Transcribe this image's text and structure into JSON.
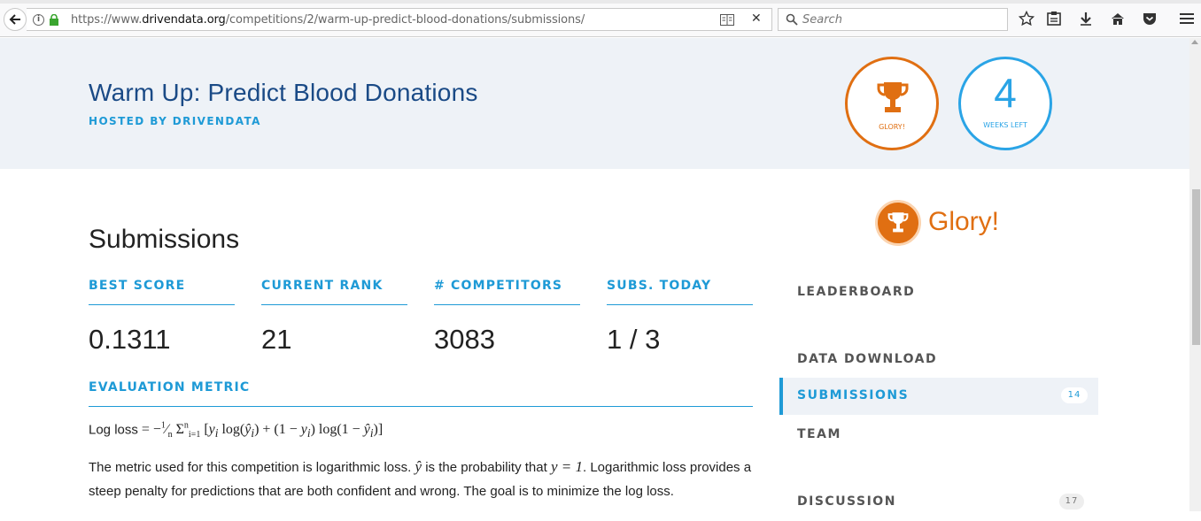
{
  "browser": {
    "url_prefix": "https://www.",
    "url_domain": "drivendata.org",
    "url_path": "/competitions/2/warm-up-predict-blood-donations/submissions/",
    "search_placeholder": "Search"
  },
  "header": {
    "title": "Warm Up: Predict Blood Donations",
    "hosted_by": "HOSTED BY DRIVENDATA",
    "glory_badge_label": "GLORY!",
    "weeks_number": "4",
    "weeks_label": "WEEKS LEFT"
  },
  "main": {
    "heading": "Submissions",
    "stats": [
      {
        "label": "BEST SCORE",
        "value": "0.1311"
      },
      {
        "label": "CURRENT RANK",
        "value": "21"
      },
      {
        "label": "# COMPETITORS",
        "value": "3083"
      },
      {
        "label": "SUBS. TODAY",
        "value": "1 / 3"
      }
    ],
    "evaluation_label": "EVALUATION METRIC",
    "formula_prefix": "Log loss",
    "para_1": "The metric used for this competition is logarithmic loss.",
    "para_2": "is the probability that",
    "para_3": ". Logarithmic loss provides a steep penalty for predictions that are both confident and wrong. The goal is to minimize the log loss."
  },
  "sidebar": {
    "prize": "Glory!",
    "nav": [
      {
        "label": "LEADERBOARD"
      },
      {
        "label": "DATA DOWNLOAD"
      },
      {
        "label": "SUBMISSIONS",
        "count": "14"
      },
      {
        "label": "TEAM"
      },
      {
        "label": "DISCUSSION",
        "count": "17"
      }
    ]
  },
  "colors": {
    "accent_blue": "#1e9ad6",
    "title_blue": "#1a4a86",
    "glory_orange": "#e06f12",
    "header_bg": "#eef2f7"
  }
}
